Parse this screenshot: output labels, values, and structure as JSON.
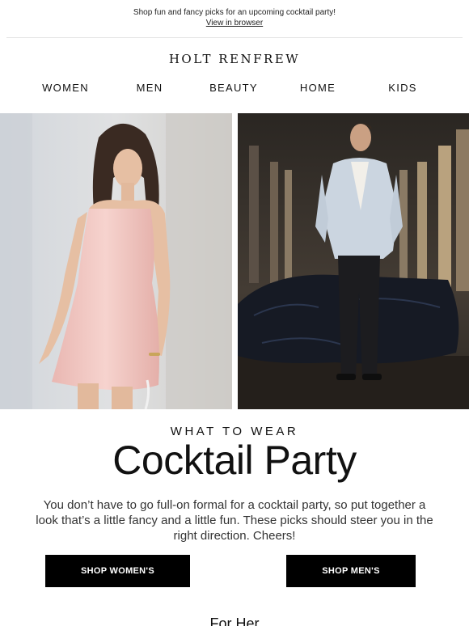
{
  "preheader": {
    "text": "Shop fun and fancy picks for an upcoming cocktail party!",
    "browser_link": "View in browser"
  },
  "brand": {
    "logo": "HOLT RENFREW"
  },
  "nav": {
    "items": [
      {
        "label": "WOMEN"
      },
      {
        "label": "MEN"
      },
      {
        "label": "BEAUTY"
      },
      {
        "label": "HOME"
      },
      {
        "label": "KIDS"
      }
    ]
  },
  "hero": {
    "left_colors": {
      "wall": "#d8dadd",
      "dress": "#f2c9c4",
      "hair": "#3a2a22",
      "skin": "#e8c1a4"
    },
    "right_colors": {
      "background": "#332e29",
      "jacket": "#c9d3de",
      "trousers": "#1c1c1f",
      "tarp": "#171a24"
    }
  },
  "content": {
    "eyebrow": "WHAT TO WEAR",
    "headline": "Cocktail Party",
    "body": "You don’t have to go full-on formal for a cocktail party, so put together a look that’s a little fancy and a little fun. These picks should steer you in the right direction. Cheers!",
    "shop_women_label": "SHOP WOMEN'S",
    "shop_men_label": "SHOP MEN'S",
    "section_heading": "For Her"
  }
}
